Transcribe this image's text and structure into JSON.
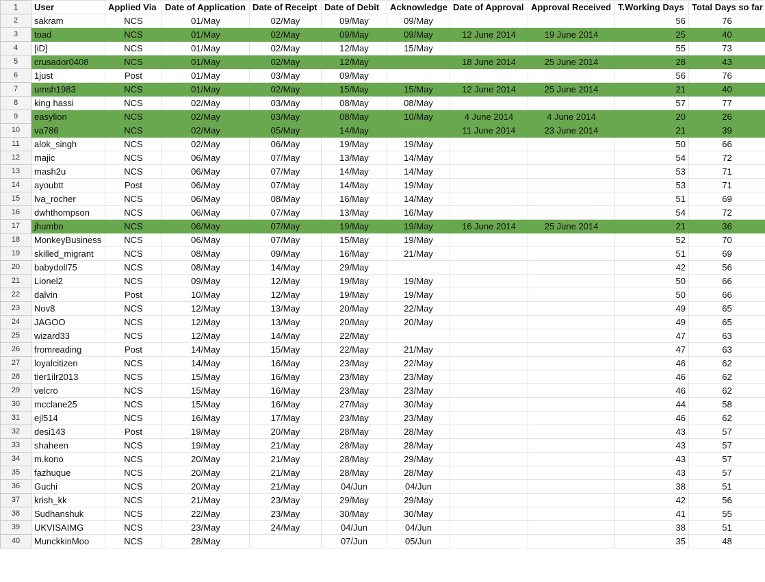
{
  "sheet": {
    "headers": [
      "User",
      "Applied Via",
      "Date of Application",
      "Date of Receipt",
      "Date of Debit",
      "Acknowledge",
      "Date of Approval",
      "Approval Received",
      "T.Working Days",
      "Total Days so far"
    ],
    "rows": [
      {
        "n": "2",
        "green": false,
        "cells": [
          "sakram",
          "NCS",
          "01/May",
          "02/May",
          "09/May",
          "09/May",
          "",
          "",
          "56",
          "76"
        ]
      },
      {
        "n": "3",
        "green": true,
        "cells": [
          "toad",
          "NCS",
          "01/May",
          "02/May",
          "09/May",
          "09/May",
          "12 June 2014",
          "19 June 2014",
          "25",
          "40"
        ]
      },
      {
        "n": "4",
        "green": false,
        "cells": [
          "[iD]",
          "NCS",
          "01/May",
          "02/May",
          "12/May",
          "15/May",
          "",
          "",
          "55",
          "73"
        ]
      },
      {
        "n": "5",
        "green": true,
        "cells": [
          "crusador0408",
          "NCS",
          "01/May",
          "02/May",
          "12/May",
          "",
          "18 June 2014",
          "25 June 2014",
          "28",
          "43"
        ]
      },
      {
        "n": "6",
        "green": false,
        "cells": [
          "1just",
          "Post",
          "01/May",
          "03/May",
          "09/May",
          "",
          "",
          "",
          "56",
          "76"
        ]
      },
      {
        "n": "7",
        "green": true,
        "cells": [
          "umsh1983",
          "NCS",
          "01/May",
          "02/May",
          "15/May",
          "15/May",
          "12 June 2014",
          "25 June 2014",
          "21",
          "40"
        ]
      },
      {
        "n": "8",
        "green": false,
        "cells": [
          "king hassi",
          "NCS",
          "02/May",
          "03/May",
          "08/May",
          "08/May",
          "",
          "",
          "57",
          "77"
        ]
      },
      {
        "n": "9",
        "green": true,
        "cells": [
          "easylion",
          "NCS",
          "02/May",
          "03/May",
          "08/May",
          "10/May",
          "4 June 2014",
          "4 June 2014",
          "20",
          "26"
        ]
      },
      {
        "n": "10",
        "green": true,
        "cells": [
          "va786",
          "NCS",
          "02/May",
          "05/May",
          "14/May",
          "",
          "11 June 2014",
          "23 June 2014",
          "21",
          "39"
        ]
      },
      {
        "n": "11",
        "green": false,
        "cells": [
          "alok_singh",
          "NCS",
          "02/May",
          "06/May",
          "19/May",
          "19/May",
          "",
          "",
          "50",
          "66"
        ]
      },
      {
        "n": "12",
        "green": false,
        "cells": [
          "majic",
          "NCS",
          "06/May",
          "07/May",
          "13/May",
          "14/May",
          "",
          "",
          "54",
          "72"
        ]
      },
      {
        "n": "13",
        "green": false,
        "cells": [
          "mash2u",
          "NCS",
          "06/May",
          "07/May",
          "14/May",
          "14/May",
          "",
          "",
          "53",
          "71"
        ]
      },
      {
        "n": "14",
        "green": false,
        "cells": [
          "ayoubtt",
          "Post",
          "06/May",
          "07/May",
          "14/May",
          "19/May",
          "",
          "",
          "53",
          "71"
        ]
      },
      {
        "n": "15",
        "green": false,
        "cells": [
          "lva_rocher",
          "NCS",
          "06/May",
          "08/May",
          "16/May",
          "14/May",
          "",
          "",
          "51",
          "69"
        ]
      },
      {
        "n": "16",
        "green": false,
        "cells": [
          "dwhthompson",
          "NCS",
          "06/May",
          "07/May",
          "13/May",
          "16/May",
          "",
          "",
          "54",
          "72"
        ]
      },
      {
        "n": "17",
        "green": true,
        "cells": [
          "jhumbo",
          "NCS",
          "06/May",
          "07/May",
          "19/May",
          "19/May",
          "16 June 2014",
          "25 June 2014",
          "21",
          "36"
        ]
      },
      {
        "n": "18",
        "green": false,
        "cells": [
          "MonkeyBusiness",
          "NCS",
          "06/May",
          "07/May",
          "15/May",
          "19/May",
          "",
          "",
          "52",
          "70"
        ]
      },
      {
        "n": "19",
        "green": false,
        "cells": [
          "skilled_migrant",
          "NCS",
          "08/May",
          "09/May",
          "16/May",
          "21/May",
          "",
          "",
          "51",
          "69"
        ]
      },
      {
        "n": "20",
        "green": false,
        "cells": [
          "babydoll75",
          "NCS",
          "08/May",
          "14/May",
          "29/May",
          "",
          "",
          "",
          "42",
          "56"
        ]
      },
      {
        "n": "21",
        "green": false,
        "cells": [
          "Lionel2",
          "NCS",
          "09/May",
          "12/May",
          "19/May",
          "19/May",
          "",
          "",
          "50",
          "66"
        ]
      },
      {
        "n": "22",
        "green": false,
        "cells": [
          "dalvin",
          "Post",
          "10/May",
          "12/May",
          "19/May",
          "19/May",
          "",
          "",
          "50",
          "66"
        ]
      },
      {
        "n": "23",
        "green": false,
        "cells": [
          "Nov8",
          "NCS",
          "12/May",
          "13/May",
          "20/May",
          "22/May",
          "",
          "",
          "49",
          "65"
        ]
      },
      {
        "n": "24",
        "green": false,
        "cells": [
          "JAGOO",
          "NCS",
          "12/May",
          "13/May",
          "20/May",
          "20/May",
          "",
          "",
          "49",
          "65"
        ]
      },
      {
        "n": "25",
        "green": false,
        "cells": [
          "wizard33",
          "NCS",
          "12/May",
          "14/May",
          "22/May",
          "",
          "",
          "",
          "47",
          "63"
        ]
      },
      {
        "n": "26",
        "green": false,
        "cells": [
          "fromreading",
          "Post",
          "14/May",
          "15/May",
          "22/May",
          "21/May",
          "",
          "",
          "47",
          "63"
        ]
      },
      {
        "n": "27",
        "green": false,
        "cells": [
          "loyalcitizen",
          "NCS",
          "14/May",
          "16/May",
          "23/May",
          "22/May",
          "",
          "",
          "46",
          "62"
        ]
      },
      {
        "n": "28",
        "green": false,
        "cells": [
          "tier1ilr2013",
          "NCS",
          "15/May",
          "16/May",
          "23/May",
          "23/May",
          "",
          "",
          "46",
          "62"
        ]
      },
      {
        "n": "29",
        "green": false,
        "cells": [
          "velcro",
          "NCS",
          "15/May",
          "16/May",
          "23/May",
          "23/May",
          "",
          "",
          "46",
          "62"
        ]
      },
      {
        "n": "30",
        "green": false,
        "cells": [
          "mcclane25",
          "NCS",
          "15/May",
          "16/May",
          "27/May",
          "30/May",
          "",
          "",
          "44",
          "58"
        ]
      },
      {
        "n": "31",
        "green": false,
        "cells": [
          "ejl514",
          "NCS",
          "16/May",
          "17/May",
          "23/May",
          "23/May",
          "",
          "",
          "46",
          "62"
        ]
      },
      {
        "n": "32",
        "green": false,
        "cells": [
          "desi143",
          "Post",
          "19/May",
          "20/May",
          "28/May",
          "28/May",
          "",
          "",
          "43",
          "57"
        ]
      },
      {
        "n": "33",
        "green": false,
        "cells": [
          "shaheen",
          "NCS",
          "19/May",
          "21/May",
          "28/May",
          "28/May",
          "",
          "",
          "43",
          "57"
        ]
      },
      {
        "n": "34",
        "green": false,
        "cells": [
          "m.kono",
          "NCS",
          "20/May",
          "21/May",
          "28/May",
          "29/May",
          "",
          "",
          "43",
          "57"
        ]
      },
      {
        "n": "35",
        "green": false,
        "cells": [
          "fazhuque",
          "NCS",
          "20/May",
          "21/May",
          "28/May",
          "28/May",
          "",
          "",
          "43",
          "57"
        ]
      },
      {
        "n": "36",
        "green": false,
        "cells": [
          "Guchi",
          "NCS",
          "20/May",
          "21/May",
          "04/Jun",
          "04/Jun",
          "",
          "",
          "38",
          "51"
        ]
      },
      {
        "n": "37",
        "green": false,
        "cells": [
          "krish_kk",
          "NCS",
          "21/May",
          "23/May",
          "29/May",
          "29/May",
          "",
          "",
          "42",
          "56"
        ]
      },
      {
        "n": "38",
        "green": false,
        "cells": [
          "Sudhanshuk",
          "NCS",
          "22/May",
          "23/May",
          "30/May",
          "30/May",
          "",
          "",
          "41",
          "55"
        ]
      },
      {
        "n": "39",
        "green": false,
        "cells": [
          "UKVISAIMG",
          "NCS",
          "23/May",
          "24/May",
          "04/Jun",
          "04/Jun",
          "",
          "",
          "38",
          "51"
        ]
      },
      {
        "n": "40",
        "green": false,
        "cells": [
          "MunckkinMoo",
          "NCS",
          "28/May",
          "",
          "07/Jun",
          "05/Jun",
          "",
          "",
          "35",
          "48"
        ]
      }
    ]
  },
  "colors": {
    "highlight": "#6aa84f",
    "row_header_bg": "#f3f3f3",
    "grid": "#e2e2e2"
  }
}
